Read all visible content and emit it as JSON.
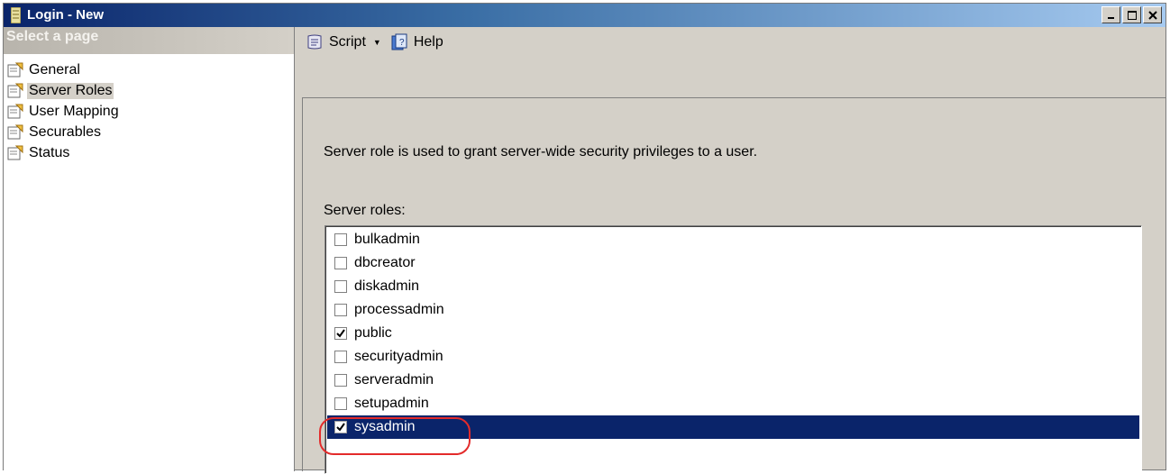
{
  "window": {
    "title": "Login - New"
  },
  "sidebar": {
    "header": "Select a page",
    "items": [
      {
        "label": "General",
        "selected": false
      },
      {
        "label": "Server Roles",
        "selected": true
      },
      {
        "label": "User Mapping",
        "selected": false
      },
      {
        "label": "Securables",
        "selected": false
      },
      {
        "label": "Status",
        "selected": false
      }
    ]
  },
  "toolbar": {
    "script_label": "Script",
    "help_label": "Help"
  },
  "content": {
    "description": "Server role is used to grant server-wide security privileges to a user.",
    "roles_label": "Server roles:",
    "roles": [
      {
        "name": "bulkadmin",
        "checked": false,
        "selected": false
      },
      {
        "name": "dbcreator",
        "checked": false,
        "selected": false
      },
      {
        "name": "diskadmin",
        "checked": false,
        "selected": false
      },
      {
        "name": "processadmin",
        "checked": false,
        "selected": false
      },
      {
        "name": "public",
        "checked": true,
        "selected": false
      },
      {
        "name": "securityadmin",
        "checked": false,
        "selected": false
      },
      {
        "name": "serveradmin",
        "checked": false,
        "selected": false
      },
      {
        "name": "setupadmin",
        "checked": false,
        "selected": false
      },
      {
        "name": "sysadmin",
        "checked": true,
        "selected": true
      }
    ]
  },
  "colors": {
    "selection": "#0a246a",
    "annotation": "#e32b2b",
    "dialog_bg": "#d4d0c8"
  }
}
